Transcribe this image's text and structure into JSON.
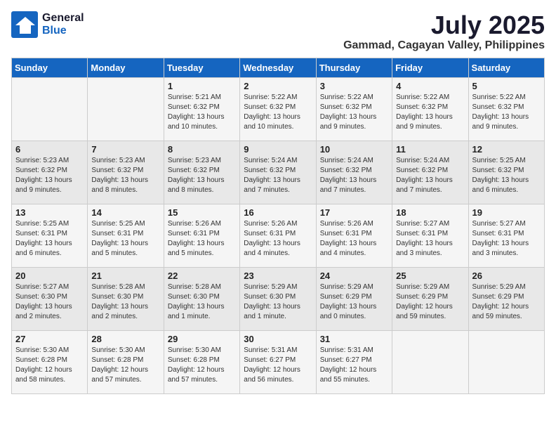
{
  "logo": {
    "general": "General",
    "blue": "Blue"
  },
  "header": {
    "month": "July 2025",
    "location": "Gammad, Cagayan Valley, Philippines"
  },
  "days_of_week": [
    "Sunday",
    "Monday",
    "Tuesday",
    "Wednesday",
    "Thursday",
    "Friday",
    "Saturday"
  ],
  "weeks": [
    [
      {
        "day": "",
        "info": ""
      },
      {
        "day": "",
        "info": ""
      },
      {
        "day": "1",
        "info": "Sunrise: 5:21 AM\nSunset: 6:32 PM\nDaylight: 13 hours\nand 10 minutes."
      },
      {
        "day": "2",
        "info": "Sunrise: 5:22 AM\nSunset: 6:32 PM\nDaylight: 13 hours\nand 10 minutes."
      },
      {
        "day": "3",
        "info": "Sunrise: 5:22 AM\nSunset: 6:32 PM\nDaylight: 13 hours\nand 9 minutes."
      },
      {
        "day": "4",
        "info": "Sunrise: 5:22 AM\nSunset: 6:32 PM\nDaylight: 13 hours\nand 9 minutes."
      },
      {
        "day": "5",
        "info": "Sunrise: 5:22 AM\nSunset: 6:32 PM\nDaylight: 13 hours\nand 9 minutes."
      }
    ],
    [
      {
        "day": "6",
        "info": "Sunrise: 5:23 AM\nSunset: 6:32 PM\nDaylight: 13 hours\nand 9 minutes."
      },
      {
        "day": "7",
        "info": "Sunrise: 5:23 AM\nSunset: 6:32 PM\nDaylight: 13 hours\nand 8 minutes."
      },
      {
        "day": "8",
        "info": "Sunrise: 5:23 AM\nSunset: 6:32 PM\nDaylight: 13 hours\nand 8 minutes."
      },
      {
        "day": "9",
        "info": "Sunrise: 5:24 AM\nSunset: 6:32 PM\nDaylight: 13 hours\nand 7 minutes."
      },
      {
        "day": "10",
        "info": "Sunrise: 5:24 AM\nSunset: 6:32 PM\nDaylight: 13 hours\nand 7 minutes."
      },
      {
        "day": "11",
        "info": "Sunrise: 5:24 AM\nSunset: 6:32 PM\nDaylight: 13 hours\nand 7 minutes."
      },
      {
        "day": "12",
        "info": "Sunrise: 5:25 AM\nSunset: 6:32 PM\nDaylight: 13 hours\nand 6 minutes."
      }
    ],
    [
      {
        "day": "13",
        "info": "Sunrise: 5:25 AM\nSunset: 6:31 PM\nDaylight: 13 hours\nand 6 minutes."
      },
      {
        "day": "14",
        "info": "Sunrise: 5:25 AM\nSunset: 6:31 PM\nDaylight: 13 hours\nand 5 minutes."
      },
      {
        "day": "15",
        "info": "Sunrise: 5:26 AM\nSunset: 6:31 PM\nDaylight: 13 hours\nand 5 minutes."
      },
      {
        "day": "16",
        "info": "Sunrise: 5:26 AM\nSunset: 6:31 PM\nDaylight: 13 hours\nand 4 minutes."
      },
      {
        "day": "17",
        "info": "Sunrise: 5:26 AM\nSunset: 6:31 PM\nDaylight: 13 hours\nand 4 minutes."
      },
      {
        "day": "18",
        "info": "Sunrise: 5:27 AM\nSunset: 6:31 PM\nDaylight: 13 hours\nand 3 minutes."
      },
      {
        "day": "19",
        "info": "Sunrise: 5:27 AM\nSunset: 6:31 PM\nDaylight: 13 hours\nand 3 minutes."
      }
    ],
    [
      {
        "day": "20",
        "info": "Sunrise: 5:27 AM\nSunset: 6:30 PM\nDaylight: 13 hours\nand 2 minutes."
      },
      {
        "day": "21",
        "info": "Sunrise: 5:28 AM\nSunset: 6:30 PM\nDaylight: 13 hours\nand 2 minutes."
      },
      {
        "day": "22",
        "info": "Sunrise: 5:28 AM\nSunset: 6:30 PM\nDaylight: 13 hours\nand 1 minute."
      },
      {
        "day": "23",
        "info": "Sunrise: 5:29 AM\nSunset: 6:30 PM\nDaylight: 13 hours\nand 1 minute."
      },
      {
        "day": "24",
        "info": "Sunrise: 5:29 AM\nSunset: 6:29 PM\nDaylight: 13 hours\nand 0 minutes."
      },
      {
        "day": "25",
        "info": "Sunrise: 5:29 AM\nSunset: 6:29 PM\nDaylight: 12 hours\nand 59 minutes."
      },
      {
        "day": "26",
        "info": "Sunrise: 5:29 AM\nSunset: 6:29 PM\nDaylight: 12 hours\nand 59 minutes."
      }
    ],
    [
      {
        "day": "27",
        "info": "Sunrise: 5:30 AM\nSunset: 6:28 PM\nDaylight: 12 hours\nand 58 minutes."
      },
      {
        "day": "28",
        "info": "Sunrise: 5:30 AM\nSunset: 6:28 PM\nDaylight: 12 hours\nand 57 minutes."
      },
      {
        "day": "29",
        "info": "Sunrise: 5:30 AM\nSunset: 6:28 PM\nDaylight: 12 hours\nand 57 minutes."
      },
      {
        "day": "30",
        "info": "Sunrise: 5:31 AM\nSunset: 6:27 PM\nDaylight: 12 hours\nand 56 minutes."
      },
      {
        "day": "31",
        "info": "Sunrise: 5:31 AM\nSunset: 6:27 PM\nDaylight: 12 hours\nand 55 minutes."
      },
      {
        "day": "",
        "info": ""
      },
      {
        "day": "",
        "info": ""
      }
    ]
  ]
}
